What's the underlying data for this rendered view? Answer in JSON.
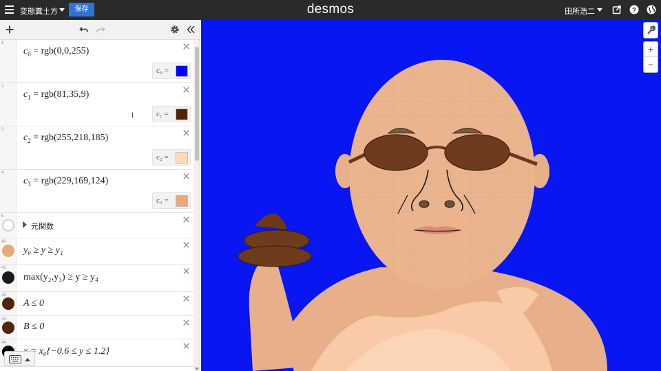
{
  "header": {
    "graph_title": "変態糞土方",
    "save_label": "保存",
    "logo": "desmos",
    "user_name": "田所浩二"
  },
  "expressions": [
    {
      "index": "1",
      "lhs": "c",
      "sub": "0",
      "rhs": "= rgb(0,0,255)",
      "swatch_label": "c₀ =",
      "swatch_color": "#0000ff"
    },
    {
      "index": "2",
      "lhs": "c",
      "sub": "1",
      "rhs": "= rgb(81,35,9)",
      "swatch_label": "c₁ =",
      "swatch_color": "#512309"
    },
    {
      "index": "3",
      "lhs": "c",
      "sub": "2",
      "rhs": "= rgb(255,218,185)",
      "swatch_label": "c₂ =",
      "swatch_color": "#ffdab9"
    },
    {
      "index": "4",
      "lhs": "c",
      "sub": "3",
      "rhs": "= rgb(229,169,124)",
      "swatch_label": "c₃ =",
      "swatch_color": "#e5a97c"
    }
  ],
  "folder": {
    "index": "5",
    "label": "元関数"
  },
  "inequalities": [
    {
      "index": "40",
      "text": "y₀ ≥ y ≥ y₁",
      "icon_color": "#e5a97c"
    },
    {
      "index": "41",
      "text": "max(y₂,y₃) ≥ y ≥ y₄",
      "icon_color": "#1a1a1a"
    },
    {
      "index": "42",
      "text": "A ≤ 0",
      "icon_color": "#512309"
    },
    {
      "index": "43",
      "text": "B ≤ 0",
      "icon_color": "#512309"
    },
    {
      "index": "44",
      "text": "x = x₀{−0.6 ≤ y ≤ 1.2}",
      "icon_color": "#000000"
    }
  ],
  "colors": {
    "header_bg": "#2a2a2a",
    "save_blue": "#2f72dc",
    "graph_bg": "#0816f1"
  },
  "icons": {
    "hamburger": "menu-icon",
    "share": "share-icon",
    "help": "help-icon",
    "language": "globe-icon",
    "add": "plus-icon",
    "undo": "undo-icon",
    "redo": "redo-icon",
    "settings": "gear-icon",
    "collapse": "double-chevron-left-icon",
    "wrench": "wrench-icon",
    "zoom_in": "plus-icon",
    "zoom_out": "minus-icon",
    "keyboard": "keyboard-icon"
  },
  "zoom": {
    "in_label": "+",
    "out_label": "−"
  }
}
